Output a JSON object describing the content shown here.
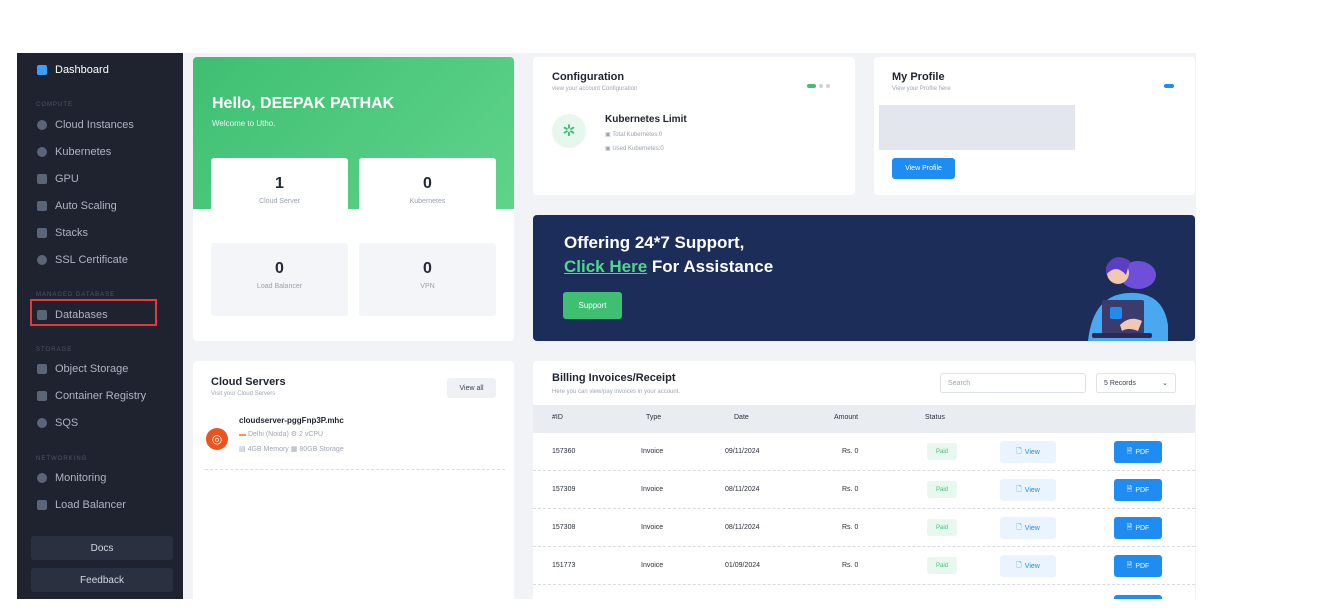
{
  "sidebar": {
    "dashboard": "Dashboard",
    "sections": {
      "compute": "COMPUTE",
      "managed_database": "MANAGED DATABASE",
      "storage": "STORAGE",
      "networking": "NETWORKING"
    },
    "items": {
      "cloud_instances": "Cloud Instances",
      "kubernetes": "Kubernetes",
      "gpu": "GPU",
      "auto_scaling": "Auto Scaling",
      "stacks": "Stacks",
      "ssl_certificate": "SSL Certificate",
      "databases": "Databases",
      "object_storage": "Object Storage",
      "container_registry": "Container Registry",
      "sqs": "SQS",
      "monitoring": "Monitoring",
      "load_balancer": "Load Balancer"
    },
    "docs_label": "Docs",
    "feedback_label": "Feedback",
    "accent_color": "#3aa0ff",
    "highlight_color": "#e33a3a"
  },
  "welcome": {
    "title": "Hello, DEEPAK PATHAK",
    "subtitle": "Welcome to Utho.",
    "stats": [
      {
        "value": "1",
        "label": "Cloud Server"
      },
      {
        "value": "0",
        "label": "Kubernetes"
      },
      {
        "value": "0",
        "label": "Load Balancer"
      },
      {
        "value": "0",
        "label": "VPN"
      }
    ],
    "accent_color": "#3fbf72"
  },
  "configuration": {
    "title": "Configuration",
    "subtitle": "view your account Configuration",
    "item_title": "Kubernetes Limit",
    "total": "Total Kubernetes:0",
    "used": "Used Kubernetes:0",
    "icon": "kubernetes-icon"
  },
  "profile": {
    "title": "My Profile",
    "subtitle": "View your Profile here",
    "button": "View Profile"
  },
  "support": {
    "line1": "Offering 24*7 Support,",
    "link": "Click Here",
    "line2_rest": " For Assistance",
    "button": "Support",
    "bg_color": "#1c2d5a"
  },
  "cloud_servers": {
    "title": "Cloud Servers",
    "subtitle": "Visit your Cloud Servers",
    "view_all": "View all",
    "server": {
      "name": "cloudserver-pggFnp3P.mhc",
      "location": "Delhi (Noida)",
      "cpu": "2 vCPU",
      "memory": "4GB Memory",
      "storage": "80GB Storage",
      "os_icon": "ubuntu-icon"
    }
  },
  "billing": {
    "title": "Billing Invoices/Receipt",
    "subtitle": "Here you can view/pay invoices in your account.",
    "search_placeholder": "Search",
    "records_select": "5 Records",
    "columns": [
      "#ID",
      "Type",
      "Date",
      "Amount",
      "Status"
    ],
    "rows": [
      {
        "id": "157360",
        "type": "Invoice",
        "date": "09/11/2024",
        "amount": "Rs. 0",
        "status": "Paid"
      },
      {
        "id": "157309",
        "type": "Invoice",
        "date": "08/11/2024",
        "amount": "Rs. 0",
        "status": "Paid"
      },
      {
        "id": "157308",
        "type": "Invoice",
        "date": "08/11/2024",
        "amount": "Rs. 0",
        "status": "Paid"
      },
      {
        "id": "151773",
        "type": "Invoice",
        "date": "01/09/2024",
        "amount": "Rs. 0",
        "status": "Paid"
      }
    ],
    "view_label": "View",
    "pdf_label": "PDF"
  }
}
